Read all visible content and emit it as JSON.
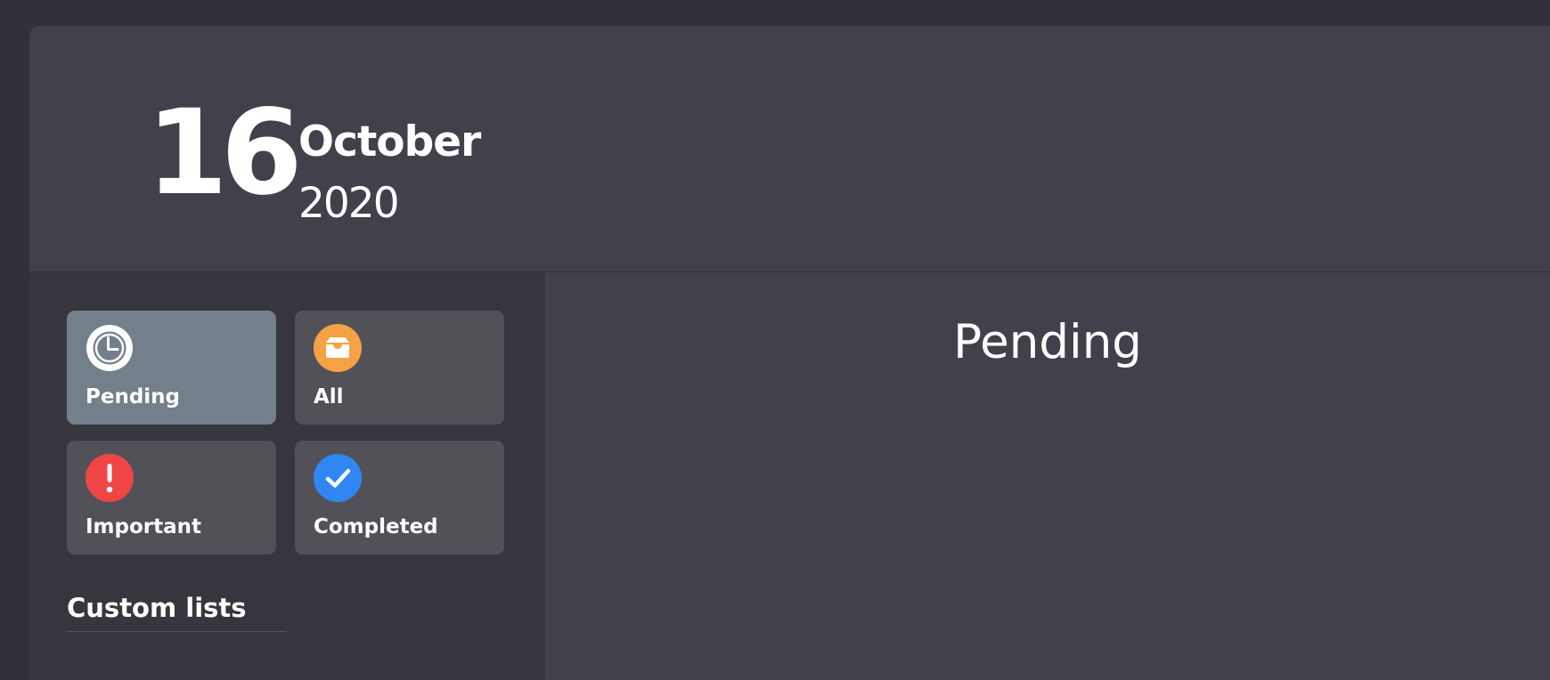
{
  "header": {
    "day": "16",
    "month": "October",
    "year": "2020"
  },
  "sidebar": {
    "tiles": [
      {
        "id": "pending",
        "label": "Pending",
        "icon": "clock-icon",
        "icon_color": "#737f8a",
        "active": true
      },
      {
        "id": "all",
        "label": "All",
        "icon": "inbox-tray-icon",
        "icon_color": "#f4a243",
        "active": false
      },
      {
        "id": "important",
        "label": "Important",
        "icon": "exclamation-icon",
        "icon_color": "#f04545",
        "active": false
      },
      {
        "id": "completed",
        "label": "Completed",
        "icon": "checkmark-icon",
        "icon_color": "#2f86f4",
        "active": false
      }
    ],
    "custom_lists_heading": "Custom lists"
  },
  "main": {
    "title": "Pending"
  },
  "colors": {
    "background": "#323139",
    "panel": "#42414b",
    "sidebar": "#37363e",
    "tile": "#525158",
    "tile_active": "#737f8a"
  }
}
